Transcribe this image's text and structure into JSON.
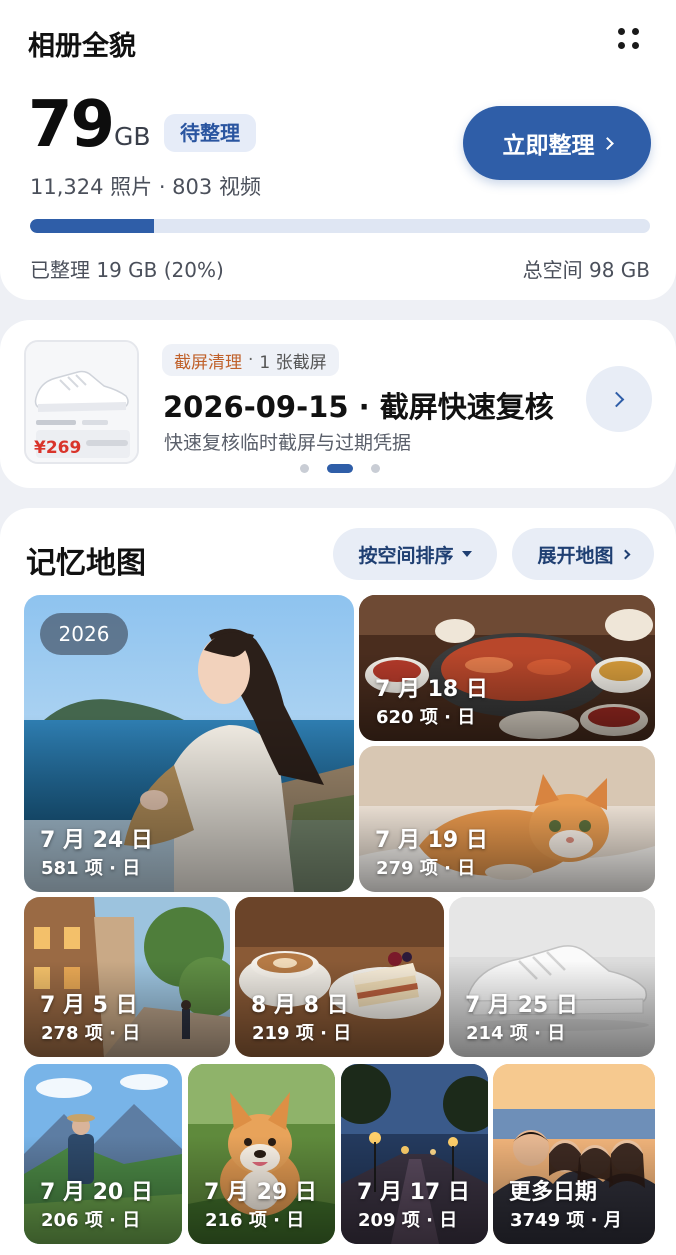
{
  "header": {
    "title": "相册全貌"
  },
  "storage": {
    "used_value": "79",
    "used_unit": "GB",
    "status_badge": "待整理",
    "counts_text": "11,324 照片 · 803 视频",
    "organize_button": "立即整理",
    "progress_fraction": 0.2,
    "organized_label": "已整理 19 GB (20%)",
    "total_label": "总空间 98 GB"
  },
  "promo": {
    "thumbnail_price": "¥269",
    "tag_category": "截屏清理",
    "tag_sep": "·",
    "tag_count": "1 张截屏",
    "title": "2026-09-15 · 截屏快速复核",
    "subtitle": "快速复核临时截屏与过期凭据",
    "carousel_pages": 3,
    "carousel_active": 2
  },
  "memory_map": {
    "title": "记忆地图",
    "sort_button": "按空间排序",
    "expand_button": "展开地图",
    "year_badge": "2026",
    "tiles": [
      {
        "date": "7 月 24 日",
        "count": "581 项 · 日",
        "scene": "woman-seaside"
      },
      {
        "date": "7 月 18 日",
        "count": "620 项 · 日",
        "scene": "hotpot-feast"
      },
      {
        "date": "7 月 19 日",
        "count": "279 项 · 日",
        "scene": "orange-cat"
      },
      {
        "date": "7 月 5 日",
        "count": "278 项 · 日",
        "scene": "european-street"
      },
      {
        "date": "8 月 8 日",
        "count": "219 项 · 日",
        "scene": "coffee-cake"
      },
      {
        "date": "7 月 25 日",
        "count": "214 项 · 日",
        "scene": "white-sneaker"
      },
      {
        "date": "7 月 20 日",
        "count": "206 项 · 日",
        "scene": "mountain-hiker"
      },
      {
        "date": "7 月 29 日",
        "count": "216 项 · 日",
        "scene": "corgi-dog"
      },
      {
        "date": "7 月 17 日",
        "count": "209 项 · 日",
        "scene": "night-street"
      },
      {
        "date": "更多日期",
        "count": "3749 项 · 月",
        "scene": "group-selfie"
      }
    ]
  },
  "colors": {
    "accent": "#2f5ea8",
    "accent_light": "#e6ecf8",
    "background": "#eef0f5",
    "price_red": "#d9342b",
    "tag_orange": "#c0612b"
  }
}
